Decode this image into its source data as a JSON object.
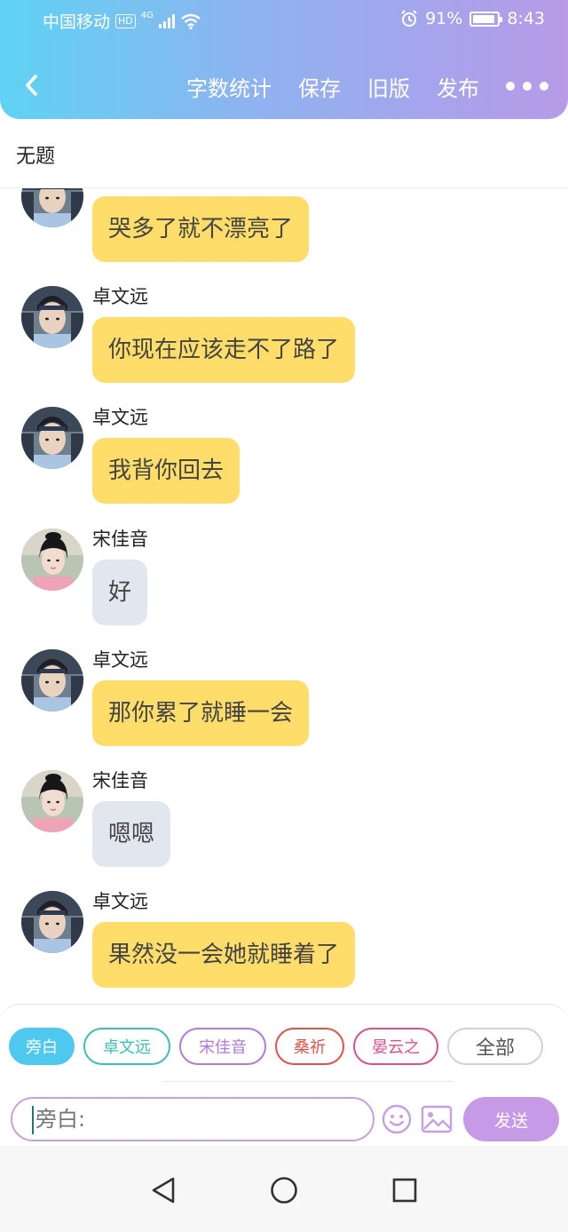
{
  "status_bar": {
    "carrier": "中国移动",
    "hd": "HD",
    "network": "4G",
    "battery": "91%",
    "time": "8:43",
    "battery_level": 0.91
  },
  "header": {
    "back_icon": "chevron-left-icon",
    "actions": [
      "字数统计",
      "保存",
      "旧版",
      "发布"
    ],
    "more_icon": "more-horizontal-icon"
  },
  "document": {
    "title": "无题"
  },
  "messages": [
    {
      "sender": "",
      "role": "male",
      "text": "哭多了就不漂亮了",
      "bubble_color": "#ffdd6a"
    },
    {
      "sender": "卓文远",
      "role": "male",
      "text": "你现在应该走不了路了",
      "bubble_color": "#ffdd6a"
    },
    {
      "sender": "卓文远",
      "role": "male",
      "text": "我背你回去",
      "bubble_color": "#ffdd6a"
    },
    {
      "sender": "宋佳音",
      "role": "female",
      "text": "好",
      "bubble_color": "#e2e6ef"
    },
    {
      "sender": "卓文远",
      "role": "male",
      "text": "那你累了就睡一会",
      "bubble_color": "#ffdd6a"
    },
    {
      "sender": "宋佳音",
      "role": "female",
      "text": "嗯嗯",
      "bubble_color": "#e2e6ef"
    },
    {
      "sender": "卓文远",
      "role": "male",
      "text": "果然没一会她就睡着了",
      "bubble_color": "#ffdd6a"
    }
  ],
  "roles": [
    {
      "label": "旁白",
      "color": "#4fc8ef",
      "selected": true
    },
    {
      "label": "卓文远",
      "color": "#3cbfb4",
      "selected": false
    },
    {
      "label": "宋佳音",
      "color": "#b27ad8",
      "selected": false
    },
    {
      "label": "桑祈",
      "color": "#e0534a",
      "selected": false
    },
    {
      "label": "晏云之",
      "color": "#e04f8a",
      "selected": false
    },
    {
      "label": "全部",
      "color": "#cccccc",
      "selected": false
    }
  ],
  "input": {
    "placeholder": "旁白:",
    "emoji_icon": "smiley-icon",
    "image_icon": "image-icon",
    "send_label": "发送"
  },
  "system_nav": {
    "back_icon": "triangle-back-icon",
    "home_icon": "circle-home-icon",
    "recent_icon": "square-recents-icon"
  },
  "colors": {
    "header_gradient_start": "#5fd3f3",
    "header_gradient_end": "#b79ae8",
    "send_button": "#c79ae8",
    "male_bubble": "#ffdd6a",
    "female_bubble": "#e2e6ef"
  }
}
